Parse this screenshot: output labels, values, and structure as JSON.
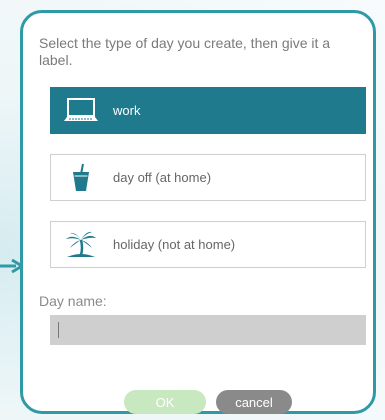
{
  "dialog": {
    "prompt": "Select the type of day you create, then give it a label.",
    "options": [
      {
        "label": "work",
        "icon": "laptop-icon",
        "selected": true
      },
      {
        "label": "day off (at home)",
        "icon": "drink-icon",
        "selected": false
      },
      {
        "label": "holiday (not at home)",
        "icon": "palm-tree-icon",
        "selected": false
      }
    ],
    "day_name": {
      "label": "Day name:",
      "value": ""
    },
    "buttons": {
      "ok": "OK",
      "cancel": "cancel"
    }
  },
  "colors": {
    "accent": "#1e7a8c",
    "border": "#2e9aa6",
    "ok_button": "#c8e8c0",
    "cancel_button": "#8a8a8a"
  }
}
